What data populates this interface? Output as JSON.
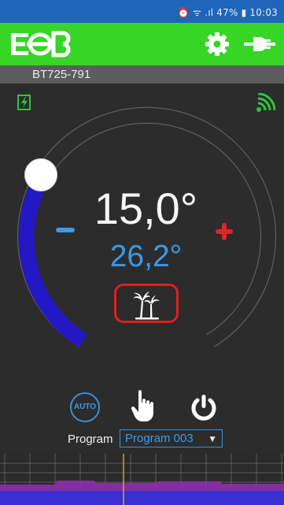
{
  "status_bar": {
    "text": "⏰ ᯤ .ıl 47% ▮ 10:03",
    "battery": "47%",
    "time": "10:03"
  },
  "app_bar": {
    "logo_text": "EOB",
    "settings_icon": "gear-icon",
    "connect_icon": "plug-icon"
  },
  "device": {
    "name": "BT725-791"
  },
  "thermostat": {
    "setpoint": "15,0°",
    "current_temperature": "26,2°",
    "minus_label": "−",
    "plus_label": "+",
    "mode_icon": "palm-tree-icon",
    "arc_level": 0.22,
    "colors": {
      "arc_fill": "#2418c4",
      "current_temp": "#3a9be8",
      "plus": "#e0242a",
      "mode_highlight": "#e0201f"
    }
  },
  "indicators": {
    "power_icon": "lightning-battery-icon",
    "signal_icon": "wireless-signal-icon"
  },
  "controls": {
    "auto_label": "AUTO",
    "manual_icon": "hand-pointer-icon",
    "power_button_icon": "power-icon"
  },
  "program": {
    "label": "Program",
    "selected": "Program 003"
  },
  "colors": {
    "status_bar": "#1e66b8",
    "app_bar": "#37d526",
    "device_bar": "#5c5c5c",
    "background": "#2c2c2c"
  }
}
